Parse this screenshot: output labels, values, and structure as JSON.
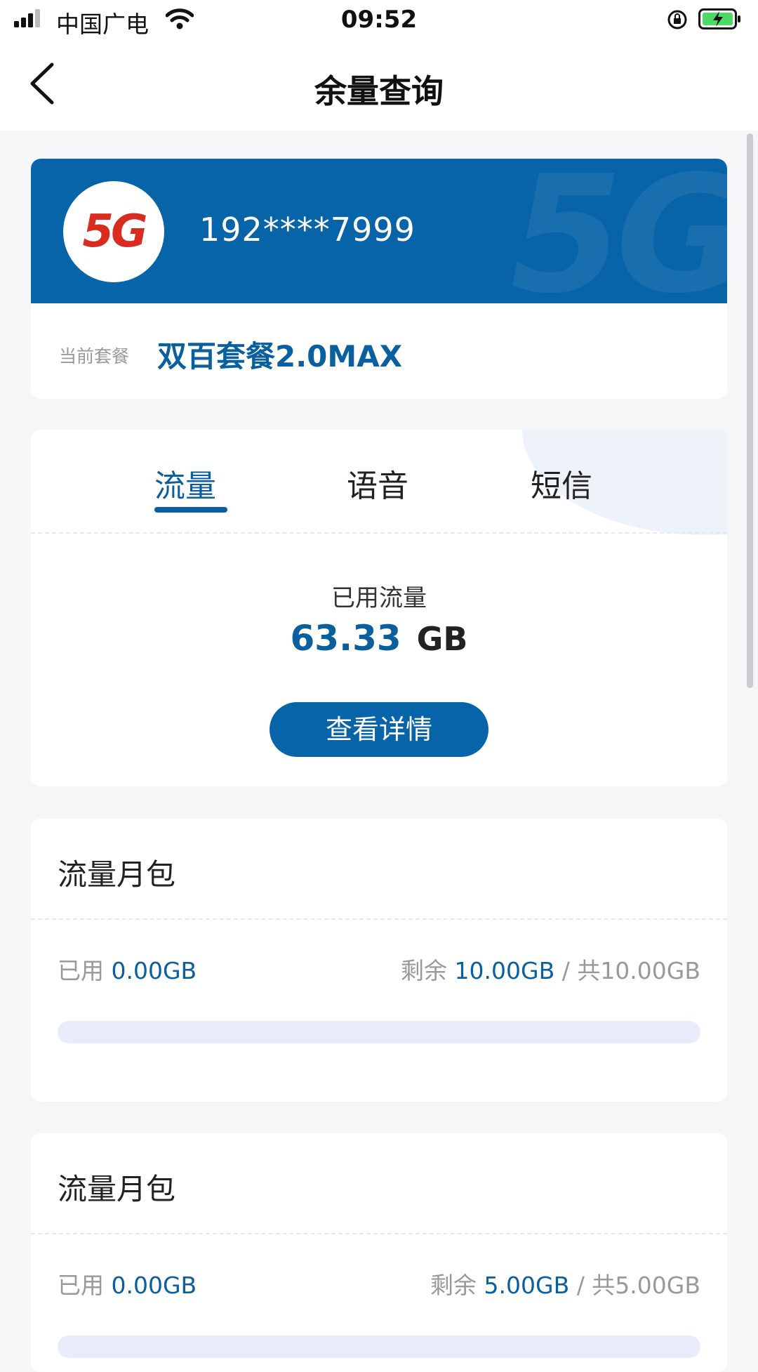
{
  "status_bar": {
    "carrier": "中国广电",
    "time": "09:52"
  },
  "nav": {
    "title": "余量查询"
  },
  "account": {
    "logo_text": "5G",
    "phone": "192****7999",
    "plan_label": "当前套餐",
    "plan_name": "双百套餐2.0MAX",
    "banner_color": "#0864a8"
  },
  "usage": {
    "tabs": [
      {
        "label": "流量",
        "active": true
      },
      {
        "label": "语音",
        "active": false
      },
      {
        "label": "短信",
        "active": false
      }
    ],
    "used_label": "已用流量",
    "used_value": "63.33",
    "used_unit": "GB",
    "details_button": "查看详情"
  },
  "packages": [
    {
      "title": "流量月包",
      "used_label": "已用",
      "used_value": "0.00GB",
      "remain_label": "剩余",
      "remain_value": "10.00GB",
      "total_text": " / 共10.00GB",
      "used_fraction": 0
    },
    {
      "title": "流量月包",
      "used_label": "已用",
      "used_value": "0.00GB",
      "remain_label": "剩余",
      "remain_value": "5.00GB",
      "total_text": " / 共5.00GB",
      "used_fraction": 0
    }
  ],
  "colors": {
    "accent": "#0a5f9e",
    "button": "#0864a8",
    "progress_track": "#e8ecfa"
  }
}
